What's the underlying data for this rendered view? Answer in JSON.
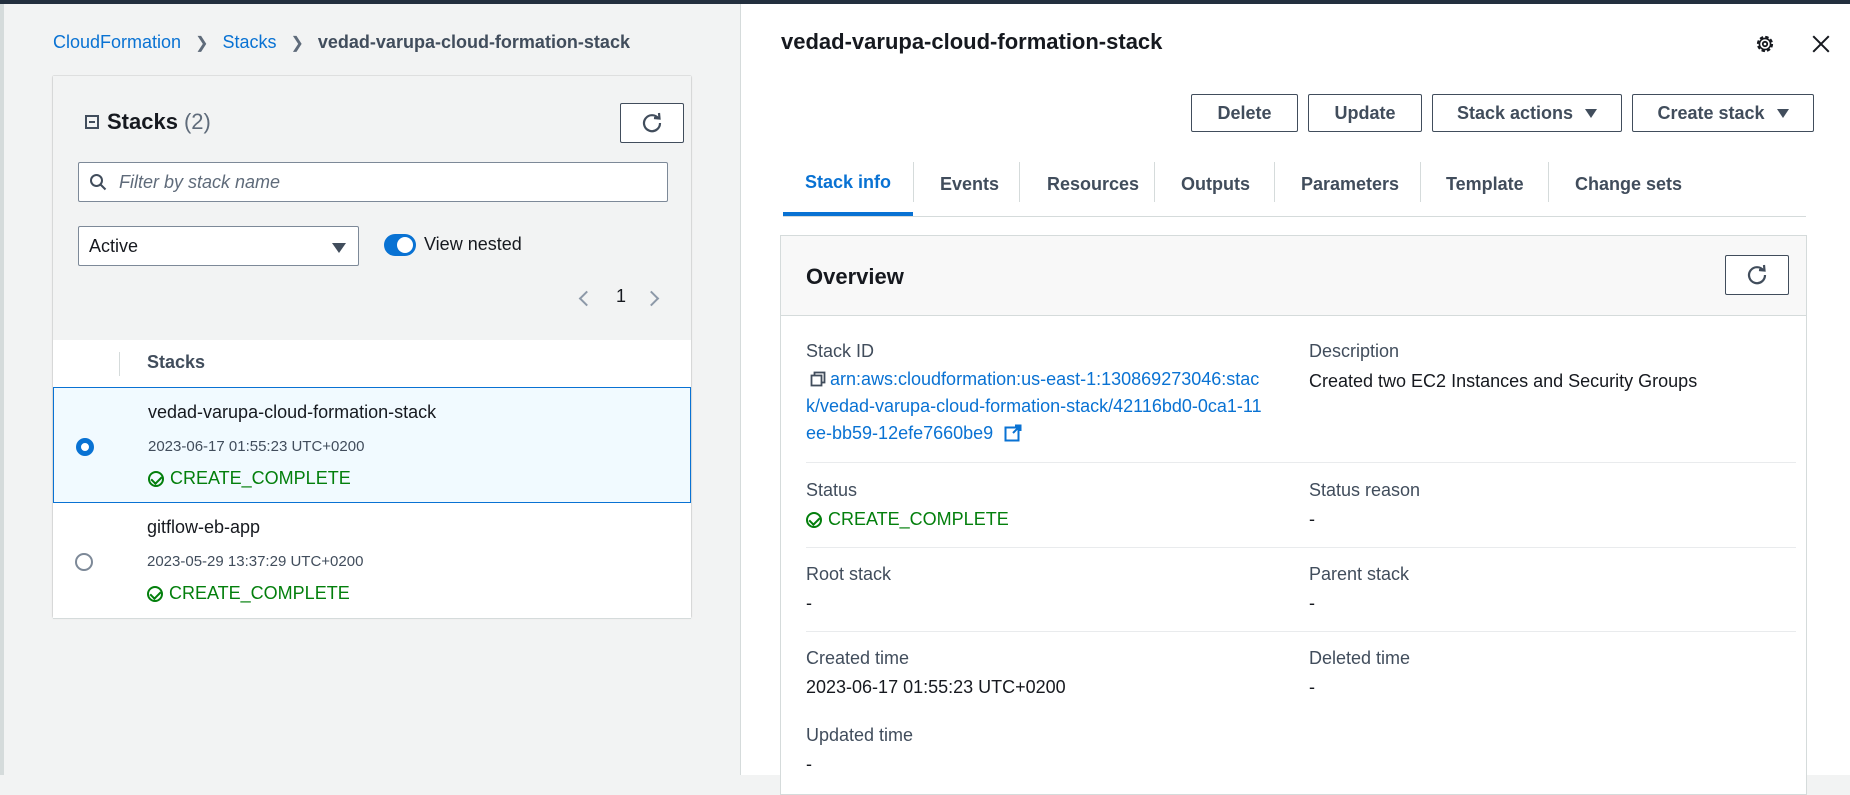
{
  "breadcrumb": {
    "root": "CloudFormation",
    "stacks": "Stacks",
    "current": "vedad-varupa-cloud-formation-stack"
  },
  "stacks_panel": {
    "title": "Stacks",
    "count": "(2)",
    "search_placeholder": "Filter by stack name",
    "filter_value": "Active",
    "view_nested_label": "View nested",
    "page": "1",
    "column_header": "Stacks",
    "rows": [
      {
        "name": "vedad-varupa-cloud-formation-stack",
        "date": "2023-06-17 01:55:23 UTC+0200",
        "status": "CREATE_COMPLETE",
        "selected": true
      },
      {
        "name": "gitflow-eb-app",
        "date": "2023-05-29 13:37:29 UTC+0200",
        "status": "CREATE_COMPLETE",
        "selected": false
      }
    ]
  },
  "detail": {
    "title": "vedad-varupa-cloud-formation-stack",
    "actions": {
      "delete": "Delete",
      "update": "Update",
      "stack_actions": "Stack actions",
      "create_stack": "Create stack"
    },
    "tabs": [
      "Stack info",
      "Events",
      "Resources",
      "Outputs",
      "Parameters",
      "Template",
      "Change sets"
    ],
    "overview": {
      "title": "Overview",
      "stack_id_label": "Stack ID",
      "stack_id_value": "arn:aws:cloudformation:us-east-1:130869273046:stack/vedad-varupa-cloud-formation-stack/42116bd0-0ca1-11ee-bb59-12efe7660be9",
      "description_label": "Description",
      "description_value": "Created two EC2 Instances and Security Groups",
      "status_label": "Status",
      "status_value": "CREATE_COMPLETE",
      "status_reason_label": "Status reason",
      "status_reason_value": "-",
      "root_stack_label": "Root stack",
      "root_stack_value": "-",
      "parent_stack_label": "Parent stack",
      "parent_stack_value": "-",
      "created_time_label": "Created time",
      "created_time_value": "2023-06-17 01:55:23 UTC+0200",
      "deleted_time_label": "Deleted time",
      "deleted_time_value": "-",
      "updated_time_label": "Updated time",
      "updated_time_value": "-"
    }
  },
  "colors": {
    "link": "#0972d3",
    "success": "#037f0c",
    "border": "#d5dbdb",
    "nav_dark": "#232f3e"
  },
  "icons": [
    "refresh-icon",
    "search-icon",
    "chevron-left-icon",
    "chevron-right-icon",
    "check-circle-icon",
    "copy-icon",
    "external-link-icon",
    "settings-icon",
    "close-icon"
  ]
}
